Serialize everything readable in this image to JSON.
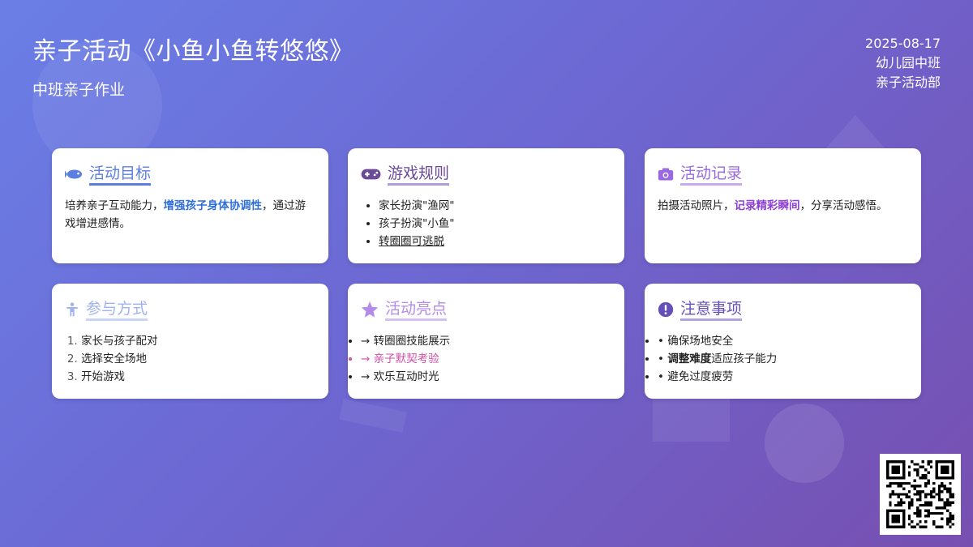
{
  "header": {
    "title": "亲子活动《小鱼小鱼转悠悠》",
    "subtitle": "中班亲子作业",
    "date": "2025-08-17",
    "class_name": "幼儿园中班",
    "department": "亲子活动部"
  },
  "colors": {
    "blue": "#5b7fe0",
    "deep_purple": "#6b4a9a",
    "purple": "#9a68e0",
    "light_blue": "#9fb4ef",
    "violet": "#b38ce8",
    "indigo": "#6650b8"
  },
  "cards": {
    "goal": {
      "title": "活动目标",
      "icon": "fish-icon",
      "text_before": "培养亲子互动能力，",
      "text_highlight": "增强孩子身体协调性",
      "text_after": "，通过游戏增进感情。"
    },
    "rules": {
      "title": "游戏规则",
      "icon": "gamepad-icon",
      "items": [
        "家长扮演\"渔网\"",
        "孩子扮演\"小鱼\"",
        "转圈圈可逃脱"
      ]
    },
    "record": {
      "title": "活动记录",
      "icon": "camera-icon",
      "text_before": "拍摄活动照片，",
      "text_highlight": "记录精彩瞬间",
      "text_after": "，分享活动感悟。"
    },
    "participation": {
      "title": "参与方式",
      "icon": "child-icon",
      "items": [
        "家长与孩子配对",
        "选择安全场地",
        "开始游戏"
      ]
    },
    "highlights": {
      "title": "活动亮点",
      "icon": "star-icon",
      "items": [
        "→ 转圈圈技能展示",
        "→ 亲子默契考验",
        "→ 欢乐互动时光"
      ]
    },
    "notes": {
      "title": "注意事项",
      "icon": "exclamation-circle-icon",
      "item1": "确保场地安全",
      "item2_bold": "调整难度",
      "item2_rest": "适应孩子能力",
      "item3": "避免过度疲劳"
    }
  },
  "qr": {
    "icon": "qr-code-icon"
  }
}
